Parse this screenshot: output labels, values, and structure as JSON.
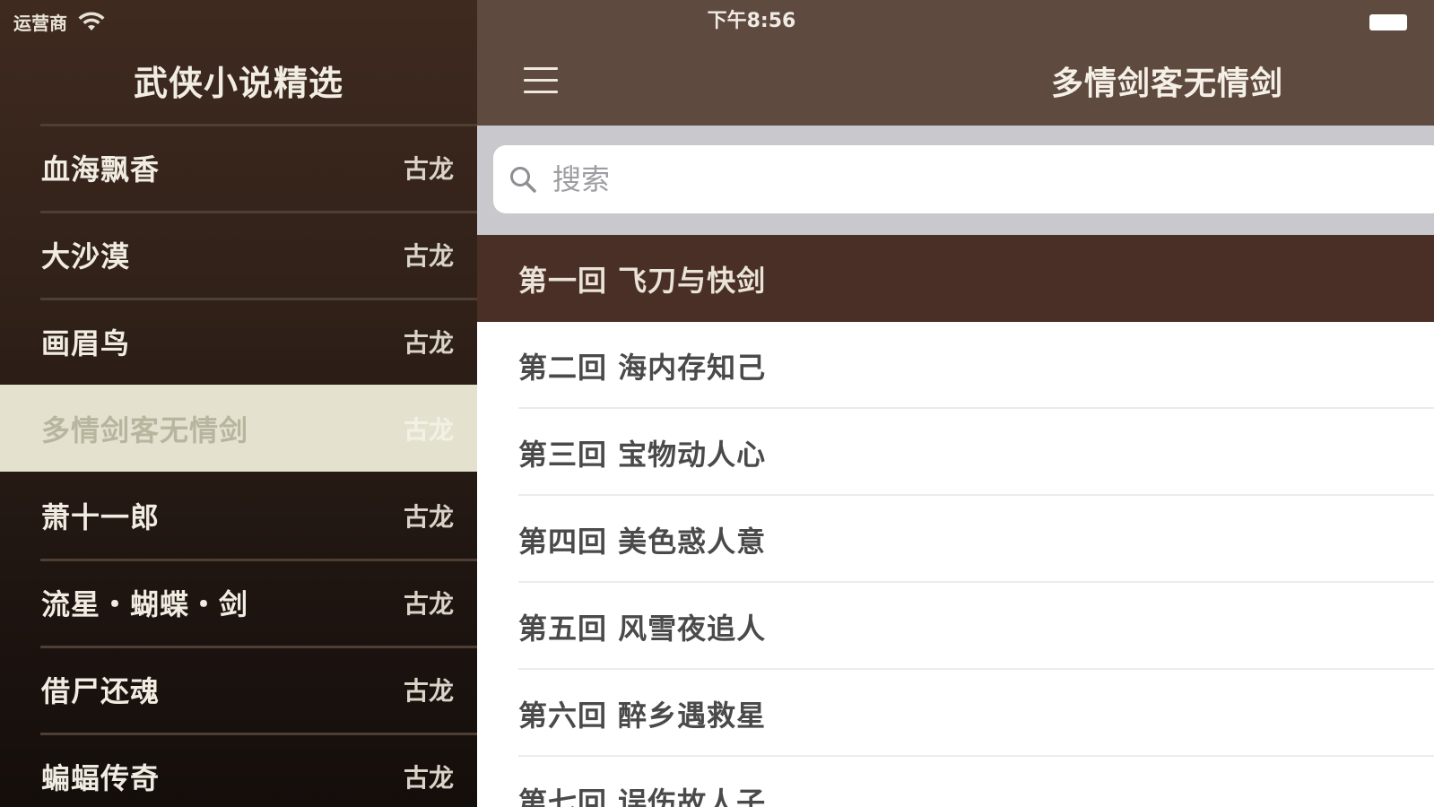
{
  "status_bar": {
    "carrier": "运营商",
    "time": "下午8:56"
  },
  "sidebar": {
    "title": "武侠小说精选",
    "books": [
      {
        "name": "血海飘香",
        "author": "古龙"
      },
      {
        "name": "大沙漠",
        "author": "古龙"
      },
      {
        "name": "画眉鸟",
        "author": "古龙"
      },
      {
        "name": "多情剑客无情剑",
        "author": "古龙",
        "selected": true
      },
      {
        "name": "萧十一郎",
        "author": "古龙"
      },
      {
        "name": "流星・蝴蝶・剑",
        "author": "古龙"
      },
      {
        "name": "借尸还魂",
        "author": "古龙"
      },
      {
        "name": "蝙蝠传奇",
        "author": "古龙"
      }
    ]
  },
  "main": {
    "nav_title": "多情剑客无情剑",
    "search": {
      "placeholder": "搜索",
      "value": ""
    },
    "chapters": [
      {
        "label": "第一回 飞刀与快剑",
        "selected": true
      },
      {
        "label": "第二回 海内存知己"
      },
      {
        "label": "第三回 宝物动人心"
      },
      {
        "label": "第四回 美色惑人意"
      },
      {
        "label": "第五回 风雪夜追人"
      },
      {
        "label": "第六回 醉乡遇救星"
      },
      {
        "label": "第七回 误伤故人子"
      }
    ]
  },
  "colors": {
    "sidebar_bg_top": "#3f2a1f",
    "sidebar_bg_bottom": "#140e0b",
    "sidebar_selected_bg": "#e4e2cf",
    "navbar_bg": "#5e4a3f",
    "chapter_selected_bg": "#4a2f26",
    "search_bar_bg": "#c8c8cd"
  },
  "icons": {
    "wifi": "wifi-icon",
    "battery": "battery-icon",
    "menu": "hamburger-menu-icon",
    "search": "search-icon"
  }
}
